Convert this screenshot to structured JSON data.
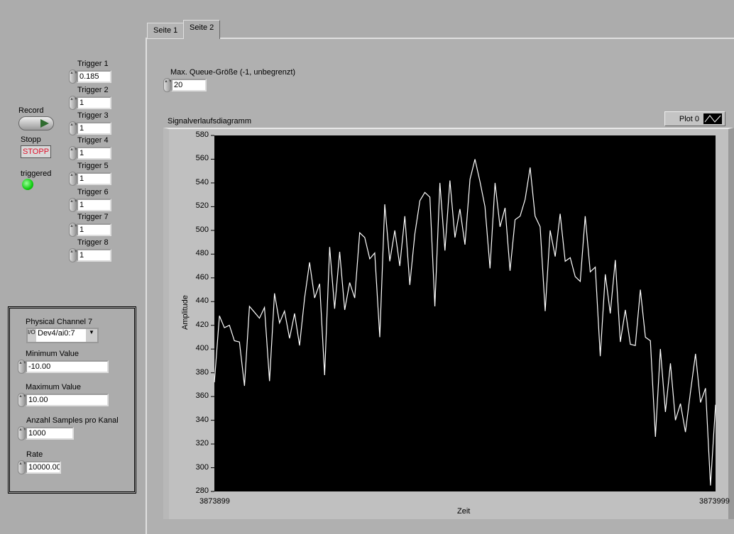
{
  "controls": {
    "record_label": "Record",
    "stop_label": "Stopp",
    "stop_button": "STOPP",
    "triggered_label": "triggered",
    "triggers": [
      {
        "label": "Trigger 1",
        "value": "0.185"
      },
      {
        "label": "Trigger 2",
        "value": "1"
      },
      {
        "label": "Trigger 3",
        "value": "1"
      },
      {
        "label": "Trigger 4",
        "value": "1"
      },
      {
        "label": "Trigger 5",
        "value": "1"
      },
      {
        "label": "Trigger 6",
        "value": "1"
      },
      {
        "label": "Trigger 7",
        "value": "1"
      },
      {
        "label": "Trigger 8",
        "value": "1"
      }
    ]
  },
  "config": {
    "channel_label": "Physical Channel 7",
    "channel_value": "Dev4/ai0:7",
    "io_glyph": "I/O",
    "min_label": "Minimum Value",
    "min_value": "-10.00",
    "max_label": "Maximum Value",
    "max_value": "10.00",
    "samples_label": "Anzahl Samples pro Kanal",
    "samples_value": "1000",
    "rate_label": "Rate",
    "rate_value": "10000.00"
  },
  "tabs": [
    {
      "label": "Seite 1",
      "active": false
    },
    {
      "label": "Seite 2",
      "active": true
    }
  ],
  "queue": {
    "label": "Max. Queue-Größe (-1, unbegrenzt)",
    "value": "20"
  },
  "chart_data": {
    "type": "line",
    "title": "Signalverlaufsdiagramm",
    "xlabel": "Zeit",
    "ylabel": "Amplitude",
    "legend": "Plot 0",
    "legend_placement": "top-right",
    "xlim": [
      3873899,
      3873999
    ],
    "ylim": [
      280,
      580
    ],
    "x_ticks": [
      "3873899",
      "3873999"
    ],
    "y_ticks": [
      "580",
      "560",
      "540",
      "520",
      "500",
      "480",
      "460",
      "440",
      "420",
      "400",
      "380",
      "360",
      "340",
      "320",
      "300",
      "280"
    ],
    "line_color": "#ffffff",
    "background": "#000000",
    "values": [
      372,
      428,
      418,
      420,
      407,
      406,
      369,
      436,
      431,
      426,
      435,
      373,
      447,
      422,
      432,
      409,
      430,
      403,
      443,
      473,
      443,
      455,
      378,
      486,
      434,
      482,
      433,
      456,
      443,
      498,
      494,
      476,
      481,
      410,
      522,
      474,
      500,
      470,
      512,
      454,
      497,
      525,
      532,
      528,
      436,
      540,
      483,
      542,
      494,
      518,
      488,
      543,
      560,
      541,
      520,
      468,
      540,
      503,
      519,
      466,
      509,
      512,
      526,
      553,
      512,
      503,
      432,
      500,
      478,
      514,
      474,
      477,
      461,
      457,
      512,
      465,
      469,
      394,
      463,
      430,
      475,
      406,
      433,
      404,
      403,
      450,
      410,
      407,
      326,
      400,
      347,
      388,
      340,
      354,
      330,
      364,
      396,
      355,
      367,
      285,
      353
    ]
  }
}
